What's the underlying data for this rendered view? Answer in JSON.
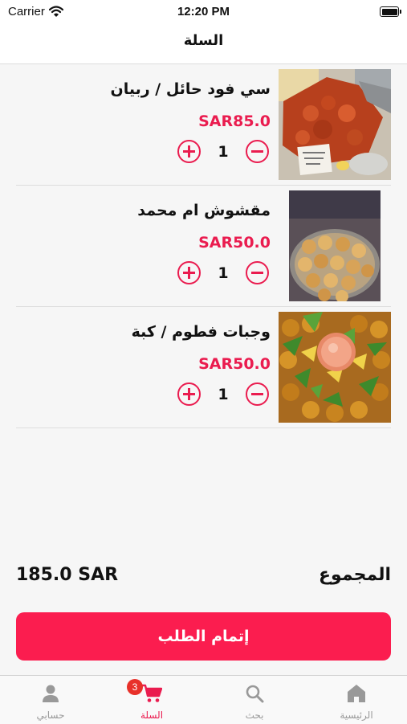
{
  "status": {
    "carrier": "Carrier",
    "time": "12:20 PM"
  },
  "nav": {
    "title": "السلة"
  },
  "items": [
    {
      "name": "سي فود حائل / ربيان",
      "price": "SAR85.0",
      "quantity": "1"
    },
    {
      "name": "مقشوش ام محمد",
      "price": "SAR50.0",
      "quantity": "1"
    },
    {
      "name": "وجبات فطوم / كبة",
      "price": "SAR50.0",
      "quantity": "1"
    }
  ],
  "summary": {
    "total_label": "المجموع",
    "total_amount": "185.0 SAR"
  },
  "checkout": {
    "label": "إتمام الطلب"
  },
  "tabbar": {
    "tabs": [
      {
        "label": "الرئيسية",
        "icon": "home-icon"
      },
      {
        "label": "بحث",
        "icon": "search-icon"
      },
      {
        "label": "السلة",
        "icon": "cart-icon",
        "badge": "3",
        "active": true
      },
      {
        "label": "حسابي",
        "icon": "person-icon"
      }
    ]
  },
  "colors": {
    "accent": "#ea1c4f",
    "checkout_button": "#fb1d4f",
    "badge": "#e8312a",
    "inactive_tab": "#999999"
  }
}
